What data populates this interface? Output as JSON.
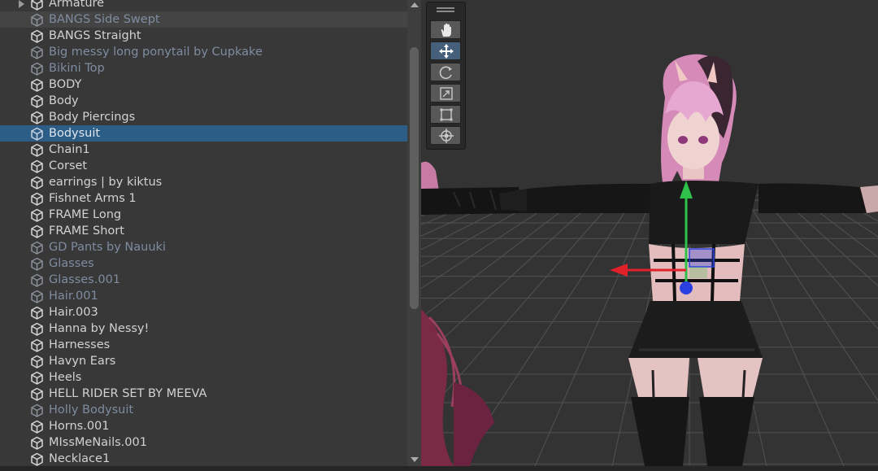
{
  "hierarchy": {
    "items": [
      {
        "label": "Armature",
        "state": "normal",
        "foldout": true
      },
      {
        "label": "BANGS Side Swept",
        "state": "inactive",
        "hover": true
      },
      {
        "label": "BANGS Straight",
        "state": "normal"
      },
      {
        "label": "Big messy long ponytail by Cupkake",
        "state": "inactive"
      },
      {
        "label": "Bikini Top",
        "state": "inactive"
      },
      {
        "label": "BODY",
        "state": "normal"
      },
      {
        "label": "Body",
        "state": "normal"
      },
      {
        "label": "Body Piercings",
        "state": "normal"
      },
      {
        "label": "Bodysuit",
        "state": "inactive",
        "selected": true
      },
      {
        "label": "Chain1",
        "state": "normal"
      },
      {
        "label": "Corset",
        "state": "normal"
      },
      {
        "label": "earrings | by kiktus",
        "state": "normal"
      },
      {
        "label": "Fishnet Arms 1",
        "state": "normal"
      },
      {
        "label": "FRAME Long",
        "state": "normal"
      },
      {
        "label": "FRAME Short",
        "state": "normal"
      },
      {
        "label": "GD Pants by Nauuki",
        "state": "inactive"
      },
      {
        "label": "Glasses",
        "state": "inactive"
      },
      {
        "label": "Glasses.001",
        "state": "inactive"
      },
      {
        "label": "Hair.001",
        "state": "inactive"
      },
      {
        "label": "Hair.003",
        "state": "normal"
      },
      {
        "label": "Hanna by Nessy!",
        "state": "normal"
      },
      {
        "label": "Harnesses",
        "state": "normal"
      },
      {
        "label": "Havyn Ears",
        "state": "normal"
      },
      {
        "label": "Heels",
        "state": "normal"
      },
      {
        "label": "HELL RIDER SET BY MEEVA",
        "state": "normal"
      },
      {
        "label": "Holly Bodysuit",
        "state": "inactive"
      },
      {
        "label": "Horns.001",
        "state": "normal"
      },
      {
        "label": "MIssMeNails.001",
        "state": "normal"
      },
      {
        "label": "Necklace1",
        "state": "normal"
      }
    ],
    "scroll_fraction": 0.1
  },
  "tools": [
    {
      "name": "hand-tool",
      "icon": "hand-icon",
      "active": false
    },
    {
      "name": "move-tool",
      "icon": "move-arrows-icon",
      "active": true
    },
    {
      "name": "rotate-tool",
      "icon": "rotate-icon",
      "active": false
    },
    {
      "name": "scale-tool",
      "icon": "scale-icon",
      "active": false
    },
    {
      "name": "rect-tool",
      "icon": "rect-transform-icon",
      "active": false
    },
    {
      "name": "transform-tool",
      "icon": "transform-icon",
      "active": false
    }
  ],
  "colors": {
    "panel_bg": "#383838",
    "selection": "#2c5d87",
    "inactive_text": "#7f8ca0",
    "text": "#d2d2d2",
    "gizmo_x": "#e0202a",
    "gizmo_y": "#2ec24a",
    "gizmo_z": "#2a40e0",
    "hair_pink": "#e6a8d0"
  }
}
